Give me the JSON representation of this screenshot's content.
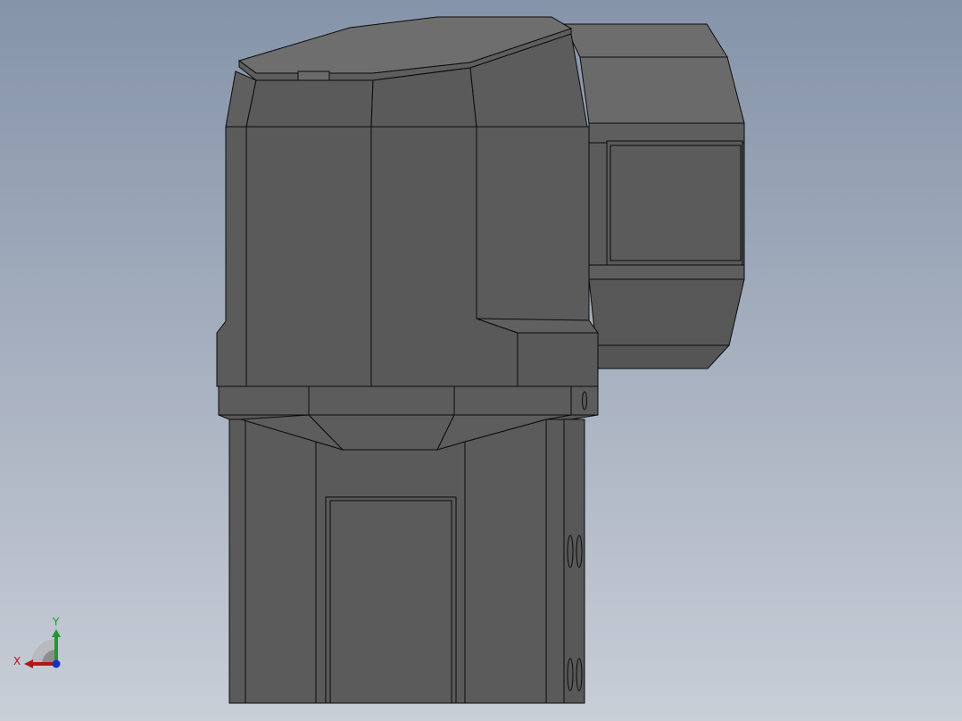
{
  "viewport": {
    "background_top": "#8594a9",
    "background_bottom": "#c9ced7"
  },
  "model": {
    "face_light": "#6b6b6b",
    "face_mid": "#5c5c5c",
    "face_dark": "#4f4f4f",
    "edge_color": "#0b0b0b"
  },
  "triad": {
    "x_label": "X",
    "y_label": "Y",
    "x_color": "#b01818",
    "y_color": "#1e9a2e",
    "z_color": "#1a2fbf"
  }
}
